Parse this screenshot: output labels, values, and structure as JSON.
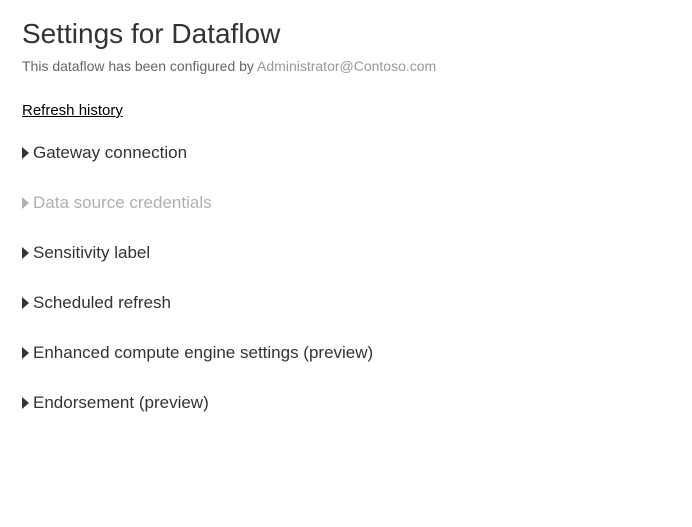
{
  "title": "Settings for Dataflow",
  "subtitle_prefix": "This dataflow has been configured by ",
  "configured_by": "Administrator@Contoso.com",
  "refresh_history_label": "Refresh history",
  "sections": {
    "gateway": "Gateway connection",
    "datasource": "Data source credentials",
    "sensitivity": "Sensitivity label",
    "scheduled": "Scheduled refresh",
    "enhanced": "Enhanced compute engine settings (preview)",
    "endorsement": "Endorsement (preview)"
  }
}
